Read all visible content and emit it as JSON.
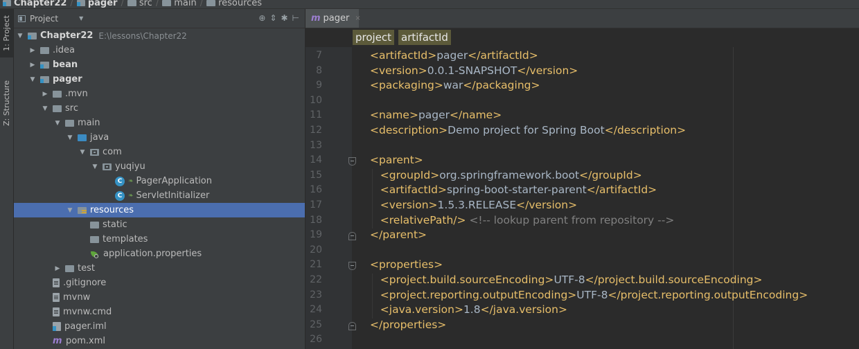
{
  "breadcrumbs": [
    "Chapter22",
    "pager",
    "src",
    "main",
    "resources"
  ],
  "tool_strip": {
    "project_tab": "1: Project",
    "structure_tab": "Z: Structure"
  },
  "project_panel": {
    "title": "Project",
    "tree": [
      {
        "label": "Chapter22",
        "path": "E:\\lessons\\Chapter22",
        "depth": 0,
        "arrow": "down",
        "icon": "module-folder",
        "bold": true
      },
      {
        "label": ".idea",
        "depth": 1,
        "arrow": "right",
        "icon": "folder"
      },
      {
        "label": "bean",
        "depth": 1,
        "arrow": "right",
        "icon": "module-folder",
        "bold": true
      },
      {
        "label": "pager",
        "depth": 1,
        "arrow": "down",
        "icon": "module-folder",
        "bold": true
      },
      {
        "label": ".mvn",
        "depth": 2,
        "arrow": "right",
        "icon": "folder"
      },
      {
        "label": "src",
        "depth": 2,
        "arrow": "down",
        "icon": "folder"
      },
      {
        "label": "main",
        "depth": 3,
        "arrow": "down",
        "icon": "folder"
      },
      {
        "label": "java",
        "depth": 4,
        "arrow": "down",
        "icon": "source-folder"
      },
      {
        "label": "com",
        "depth": 5,
        "arrow": "down",
        "icon": "package"
      },
      {
        "label": "yuqiyu",
        "depth": 6,
        "arrow": "down",
        "icon": "package"
      },
      {
        "label": "PagerApplication",
        "depth": 7,
        "arrow": "",
        "icon": "spring-class"
      },
      {
        "label": "ServletInitializer",
        "depth": 7,
        "arrow": "",
        "icon": "class"
      },
      {
        "label": "resources",
        "depth": 4,
        "arrow": "down",
        "icon": "resources-folder",
        "selected": true
      },
      {
        "label": "static",
        "depth": 5,
        "arrow": "",
        "icon": "folder"
      },
      {
        "label": "templates",
        "depth": 5,
        "arrow": "",
        "icon": "folder"
      },
      {
        "label": "application.properties",
        "depth": 5,
        "arrow": "",
        "icon": "spring-leaf"
      },
      {
        "label": "test",
        "depth": 3,
        "arrow": "right",
        "icon": "folder"
      },
      {
        "label": ".gitignore",
        "depth": 2,
        "arrow": "",
        "icon": "file"
      },
      {
        "label": "mvnw",
        "depth": 2,
        "arrow": "",
        "icon": "file"
      },
      {
        "label": "mvnw.cmd",
        "depth": 2,
        "arrow": "",
        "icon": "file"
      },
      {
        "label": "pager.iml",
        "depth": 2,
        "arrow": "",
        "icon": "iml-file"
      },
      {
        "label": "pom.xml",
        "depth": 2,
        "arrow": "",
        "icon": "maven-file"
      }
    ]
  },
  "editor": {
    "tab_icon": "m",
    "tab_label": "pager",
    "tab_close": "×",
    "breadcrumb": [
      "project",
      "artifactId"
    ],
    "lines": [
      {
        "n": 7,
        "text": "<artifactId>pager</artifactId>"
      },
      {
        "n": 8,
        "text": "<version>0.0.1-SNAPSHOT</version>"
      },
      {
        "n": 9,
        "text": "<packaging>war</packaging>"
      },
      {
        "n": 10,
        "text": ""
      },
      {
        "n": 11,
        "text": "<name>pager</name>"
      },
      {
        "n": 12,
        "text": "<description>Demo project for Spring Boot</description>"
      },
      {
        "n": 13,
        "text": ""
      },
      {
        "n": 14,
        "text": "<parent>",
        "fold": "top"
      },
      {
        "n": 15,
        "text": "   <groupId>org.springframework.boot</groupId>"
      },
      {
        "n": 16,
        "text": "   <artifactId>spring-boot-starter-parent</artifactId>"
      },
      {
        "n": 17,
        "text": "   <version>1.5.3.RELEASE</version>"
      },
      {
        "n": 18,
        "text": "   <relativePath/> <!-- lookup parent from repository -->"
      },
      {
        "n": 19,
        "text": "</parent>",
        "fold": "bot"
      },
      {
        "n": 20,
        "text": ""
      },
      {
        "n": 21,
        "text": "<properties>",
        "fold": "top"
      },
      {
        "n": 22,
        "text": "   <project.build.sourceEncoding>UTF-8</project.build.sourceEncoding>"
      },
      {
        "n": 23,
        "text": "   <project.reporting.outputEncoding>UTF-8</project.reporting.outputEncoding>"
      },
      {
        "n": 24,
        "text": "   <java.version>1.8</java.version>"
      },
      {
        "n": 25,
        "text": "</properties>",
        "fold": "bot"
      },
      {
        "n": 26,
        "text": ""
      }
    ]
  },
  "colors": {
    "tag": "#e8bf6a",
    "text": "#a9b7c6",
    "comment": "#808080",
    "selection": "#4b6eaf",
    "breadcrumb_highlight": "#5c5a3a"
  }
}
